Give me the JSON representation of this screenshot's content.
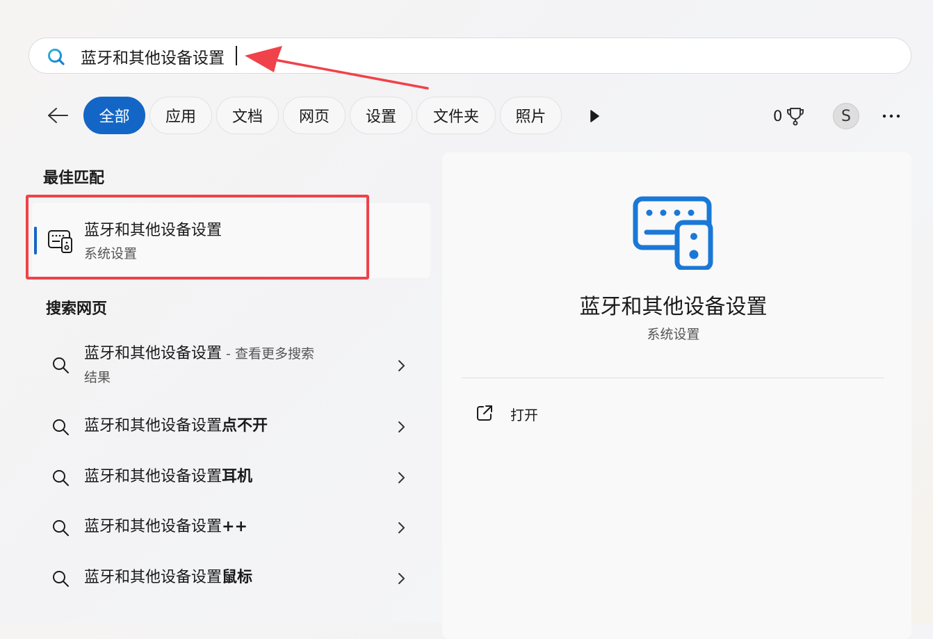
{
  "search": {
    "value": "蓝牙和其他设备设置",
    "icon": "search-icon"
  },
  "filters": {
    "back_icon": "arrow-left-icon",
    "chips": [
      {
        "label": "全部",
        "active": true
      },
      {
        "label": "应用",
        "active": false
      },
      {
        "label": "文档",
        "active": false
      },
      {
        "label": "网页",
        "active": false
      },
      {
        "label": "设置",
        "active": false
      },
      {
        "label": "文件夹",
        "active": false
      },
      {
        "label": "照片",
        "active": false
      }
    ],
    "more_icon": "play-arrow-icon"
  },
  "account": {
    "rewards_count": "0",
    "rewards_icon": "trophy-icon",
    "avatar_initial": "S",
    "more_icon": "ellipsis-icon"
  },
  "best_match": {
    "heading": "最佳匹配",
    "title": "蓝牙和其他设备设置",
    "subtitle": "系统设置",
    "icon": "devices-icon"
  },
  "web_search": {
    "heading": "搜索网页",
    "results": [
      {
        "prefix": "蓝牙和其他设备设置",
        "bold": "",
        "suffix": " - 查看更多搜索",
        "suffix2": "结果"
      },
      {
        "prefix": "蓝牙和其他设备设置",
        "bold": "点不开",
        "suffix": "",
        "suffix2": ""
      },
      {
        "prefix": "蓝牙和其他设备设置",
        "bold": "耳机",
        "suffix": "",
        "suffix2": ""
      },
      {
        "prefix": "蓝牙和其他设备设置",
        "bold": "++",
        "suffix": "",
        "suffix2": ""
      },
      {
        "prefix": "蓝牙和其他设备设置",
        "bold": "鼠标",
        "suffix": "",
        "suffix2": ""
      }
    ]
  },
  "details": {
    "title": "蓝牙和其他设备设置",
    "subtitle": "系统设置",
    "icon": "devices-icon",
    "actions": [
      {
        "label": "打开",
        "icon": "open-external-icon"
      }
    ]
  },
  "colors": {
    "accent": "#1466c6",
    "annotation": "#f0424a"
  }
}
